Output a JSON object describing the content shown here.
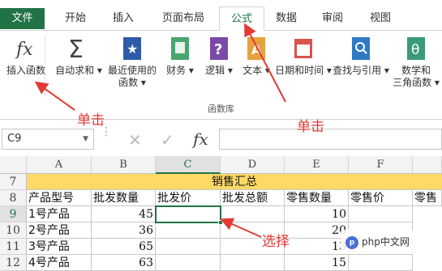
{
  "tabs": {
    "file": "文件",
    "home": "开始",
    "insert": "插入",
    "layout": "页面布局",
    "formulas": "公式",
    "data": "数据",
    "review": "审阅",
    "view": "视图"
  },
  "ribbon": {
    "insert_function": "插入函数",
    "autosum": "自动求和",
    "recent_line1": "最近使用的",
    "recent_line2": "函数",
    "financial": "财务",
    "logical": "逻辑",
    "text": "文本",
    "datetime": "日期和时间",
    "lookup": "查找与引用",
    "math_line1": "数学和",
    "math_line2": "三角函数",
    "group_label": "函数库"
  },
  "formula_bar": {
    "name_box": "C9",
    "fx_label": "fx"
  },
  "grid": {
    "columns": [
      "A",
      "B",
      "C",
      "D",
      "E",
      "F"
    ],
    "rows": [
      "7",
      "8",
      "9",
      "10",
      "11",
      "12"
    ],
    "title": "销售汇总",
    "headers": [
      "产品型号",
      "批发数量",
      "批发价",
      "批发总额",
      "零售数量",
      "零售价",
      "零售"
    ],
    "data": [
      {
        "model": "1号产品",
        "wholesale_qty": "45",
        "retail_qty": "10"
      },
      {
        "model": "2号产品",
        "wholesale_qty": "36",
        "retail_qty": "20"
      },
      {
        "model": "3号产品",
        "wholesale_qty": "65",
        "retail_qty": "13"
      },
      {
        "model": "4号产品",
        "wholesale_qty": "63",
        "retail_qty": "15"
      }
    ]
  },
  "annotations": {
    "click1": "单击",
    "click2": "单击",
    "select": "选择"
  },
  "watermark": "php中文网",
  "colors": {
    "accent": "#217346",
    "title_fill": "#ffd966",
    "annotation": "#e53935"
  }
}
